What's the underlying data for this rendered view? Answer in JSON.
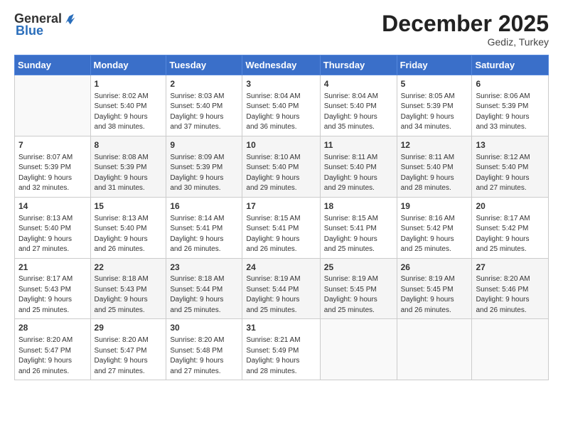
{
  "header": {
    "logo_general": "General",
    "logo_blue": "Blue",
    "month_title": "December 2025",
    "location": "Gediz, Turkey"
  },
  "days_of_week": [
    "Sunday",
    "Monday",
    "Tuesday",
    "Wednesday",
    "Thursday",
    "Friday",
    "Saturday"
  ],
  "weeks": [
    [
      {
        "day": "",
        "info": ""
      },
      {
        "day": "1",
        "info": "Sunrise: 8:02 AM\nSunset: 5:40 PM\nDaylight: 9 hours\nand 38 minutes."
      },
      {
        "day": "2",
        "info": "Sunrise: 8:03 AM\nSunset: 5:40 PM\nDaylight: 9 hours\nand 37 minutes."
      },
      {
        "day": "3",
        "info": "Sunrise: 8:04 AM\nSunset: 5:40 PM\nDaylight: 9 hours\nand 36 minutes."
      },
      {
        "day": "4",
        "info": "Sunrise: 8:04 AM\nSunset: 5:40 PM\nDaylight: 9 hours\nand 35 minutes."
      },
      {
        "day": "5",
        "info": "Sunrise: 8:05 AM\nSunset: 5:39 PM\nDaylight: 9 hours\nand 34 minutes."
      },
      {
        "day": "6",
        "info": "Sunrise: 8:06 AM\nSunset: 5:39 PM\nDaylight: 9 hours\nand 33 minutes."
      }
    ],
    [
      {
        "day": "7",
        "info": "Sunrise: 8:07 AM\nSunset: 5:39 PM\nDaylight: 9 hours\nand 32 minutes."
      },
      {
        "day": "8",
        "info": "Sunrise: 8:08 AM\nSunset: 5:39 PM\nDaylight: 9 hours\nand 31 minutes."
      },
      {
        "day": "9",
        "info": "Sunrise: 8:09 AM\nSunset: 5:39 PM\nDaylight: 9 hours\nand 30 minutes."
      },
      {
        "day": "10",
        "info": "Sunrise: 8:10 AM\nSunset: 5:40 PM\nDaylight: 9 hours\nand 29 minutes."
      },
      {
        "day": "11",
        "info": "Sunrise: 8:11 AM\nSunset: 5:40 PM\nDaylight: 9 hours\nand 29 minutes."
      },
      {
        "day": "12",
        "info": "Sunrise: 8:11 AM\nSunset: 5:40 PM\nDaylight: 9 hours\nand 28 minutes."
      },
      {
        "day": "13",
        "info": "Sunrise: 8:12 AM\nSunset: 5:40 PM\nDaylight: 9 hours\nand 27 minutes."
      }
    ],
    [
      {
        "day": "14",
        "info": "Sunrise: 8:13 AM\nSunset: 5:40 PM\nDaylight: 9 hours\nand 27 minutes."
      },
      {
        "day": "15",
        "info": "Sunrise: 8:13 AM\nSunset: 5:40 PM\nDaylight: 9 hours\nand 26 minutes."
      },
      {
        "day": "16",
        "info": "Sunrise: 8:14 AM\nSunset: 5:41 PM\nDaylight: 9 hours\nand 26 minutes."
      },
      {
        "day": "17",
        "info": "Sunrise: 8:15 AM\nSunset: 5:41 PM\nDaylight: 9 hours\nand 26 minutes."
      },
      {
        "day": "18",
        "info": "Sunrise: 8:15 AM\nSunset: 5:41 PM\nDaylight: 9 hours\nand 25 minutes."
      },
      {
        "day": "19",
        "info": "Sunrise: 8:16 AM\nSunset: 5:42 PM\nDaylight: 9 hours\nand 25 minutes."
      },
      {
        "day": "20",
        "info": "Sunrise: 8:17 AM\nSunset: 5:42 PM\nDaylight: 9 hours\nand 25 minutes."
      }
    ],
    [
      {
        "day": "21",
        "info": "Sunrise: 8:17 AM\nSunset: 5:43 PM\nDaylight: 9 hours\nand 25 minutes."
      },
      {
        "day": "22",
        "info": "Sunrise: 8:18 AM\nSunset: 5:43 PM\nDaylight: 9 hours\nand 25 minutes."
      },
      {
        "day": "23",
        "info": "Sunrise: 8:18 AM\nSunset: 5:44 PM\nDaylight: 9 hours\nand 25 minutes."
      },
      {
        "day": "24",
        "info": "Sunrise: 8:19 AM\nSunset: 5:44 PM\nDaylight: 9 hours\nand 25 minutes."
      },
      {
        "day": "25",
        "info": "Sunrise: 8:19 AM\nSunset: 5:45 PM\nDaylight: 9 hours\nand 25 minutes."
      },
      {
        "day": "26",
        "info": "Sunrise: 8:19 AM\nSunset: 5:45 PM\nDaylight: 9 hours\nand 26 minutes."
      },
      {
        "day": "27",
        "info": "Sunrise: 8:20 AM\nSunset: 5:46 PM\nDaylight: 9 hours\nand 26 minutes."
      }
    ],
    [
      {
        "day": "28",
        "info": "Sunrise: 8:20 AM\nSunset: 5:47 PM\nDaylight: 9 hours\nand 26 minutes."
      },
      {
        "day": "29",
        "info": "Sunrise: 8:20 AM\nSunset: 5:47 PM\nDaylight: 9 hours\nand 27 minutes."
      },
      {
        "day": "30",
        "info": "Sunrise: 8:20 AM\nSunset: 5:48 PM\nDaylight: 9 hours\nand 27 minutes."
      },
      {
        "day": "31",
        "info": "Sunrise: 8:21 AM\nSunset: 5:49 PM\nDaylight: 9 hours\nand 28 minutes."
      },
      {
        "day": "",
        "info": ""
      },
      {
        "day": "",
        "info": ""
      },
      {
        "day": "",
        "info": ""
      }
    ]
  ]
}
